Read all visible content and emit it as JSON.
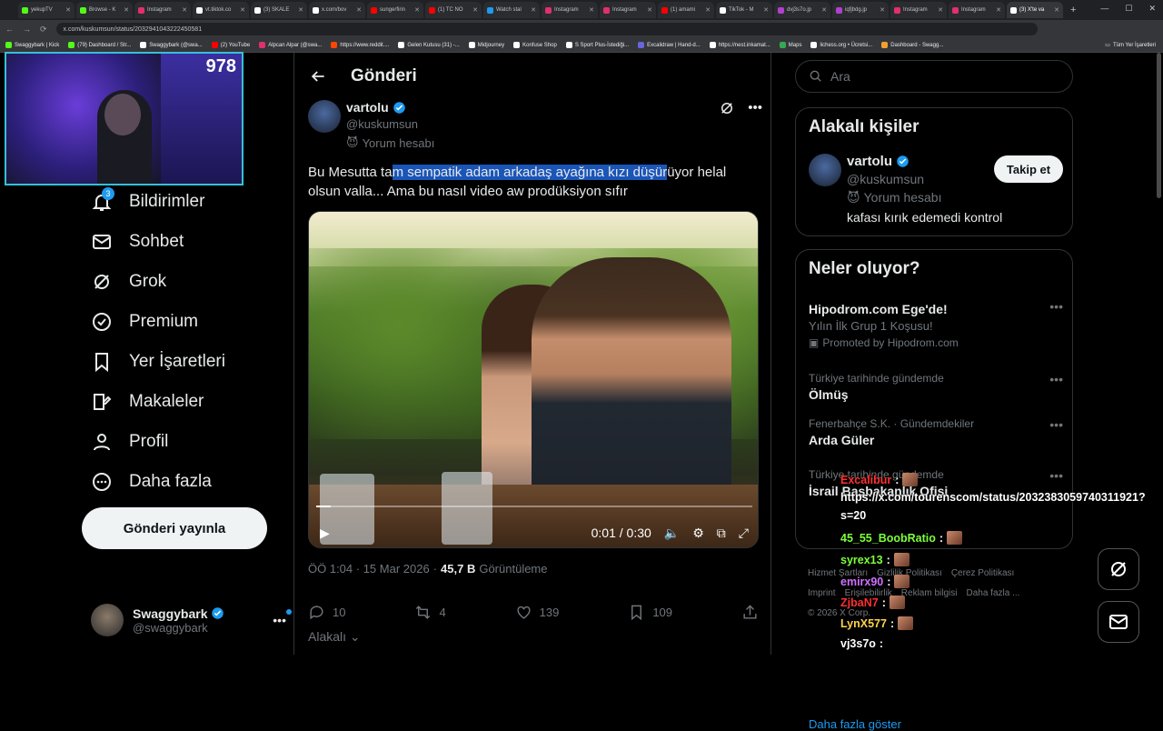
{
  "browser": {
    "tabs": [
      {
        "label": "yekupTV",
        "color": "#53fc18"
      },
      {
        "label": "Browse - K",
        "color": "#53fc18"
      },
      {
        "label": "Instagram",
        "color": "#e1306c"
      },
      {
        "label": "vt.tiktok.co",
        "color": "#ffffff"
      },
      {
        "label": "(3) SKALE",
        "color": "#ffffff"
      },
      {
        "label": "x.com/bov",
        "color": "#ffffff"
      },
      {
        "label": "sungerfirin",
        "color": "#ff0000"
      },
      {
        "label": "(1) TC NO",
        "color": "#ff0000"
      },
      {
        "label": "Watch stal",
        "color": "#1d9bf0"
      },
      {
        "label": "Instagram",
        "color": "#e1306c"
      },
      {
        "label": "Instagram",
        "color": "#e1306c"
      },
      {
        "label": "(1) amami",
        "color": "#ff0000"
      },
      {
        "label": "TikTok - M",
        "color": "#ffffff"
      },
      {
        "label": "dvj3s7o.jp",
        "color": "#b040d0"
      },
      {
        "label": "iqfjbdg.jp",
        "color": "#b040d0"
      },
      {
        "label": "Instagram",
        "color": "#e1306c"
      },
      {
        "label": "Instagram",
        "color": "#e1306c"
      },
      {
        "label": "(3) X'te va",
        "color": "#ffffff"
      }
    ],
    "url": "x.com/kuskumsun/status/2032941043222450581",
    "bookmarks": [
      {
        "label": "Swaggybark | Kick",
        "color": "#53fc18"
      },
      {
        "label": "(79) Dashboard / Str...",
        "color": "#53fc18"
      },
      {
        "label": "Swaggybark (@swa...",
        "color": "#ffffff"
      },
      {
        "label": "(2) YouTube",
        "color": "#ff0000"
      },
      {
        "label": "Alpcan Alpar (@swa...",
        "color": "#e1306c"
      },
      {
        "label": "https://www.reddit....",
        "color": "#ff4500"
      },
      {
        "label": "Gelen Kutusu (31) -...",
        "color": "#ffffff"
      },
      {
        "label": "Midjourney",
        "color": "#ffffff"
      },
      {
        "label": "Konfuse Shop",
        "color": "#ffffff"
      },
      {
        "label": "S Sport Plus-İstediği...",
        "color": "#ffffff"
      },
      {
        "label": "Excalidraw | Hand-d...",
        "color": "#6965db"
      },
      {
        "label": "https://nest.inkamat...",
        "color": "#ffffff"
      },
      {
        "label": "Maps",
        "color": "#34a853"
      },
      {
        "label": "lichess.org • Ücretsi...",
        "color": "#ffffff"
      },
      {
        "label": "Dashboard - Swagg...",
        "color": "#f0a030"
      }
    ],
    "all_bookmarks": "Tüm Yer İşaretleri"
  },
  "webcam": {
    "viewer_count": "978"
  },
  "sidebar": {
    "notif_badge": "3",
    "items": [
      {
        "label": "Bildirimler",
        "icon": "bell-icon"
      },
      {
        "label": "Sohbet",
        "icon": "mail-icon"
      },
      {
        "label": "Grok",
        "icon": "grok-icon"
      },
      {
        "label": "Premium",
        "icon": "premium-icon"
      },
      {
        "label": "Yer İşaretleri",
        "icon": "bookmark-icon"
      },
      {
        "label": "Makaleler",
        "icon": "article-icon"
      },
      {
        "label": "Profil",
        "icon": "profile-icon"
      },
      {
        "label": "Daha fazla",
        "icon": "more-circle-icon"
      }
    ],
    "post_button": "Gönderi yayınla",
    "account": {
      "name": "Swaggybark",
      "handle": "@swaggybark"
    }
  },
  "post": {
    "header": "Gönderi",
    "author": {
      "name": "vartolu",
      "handle": "@kuskumsun",
      "account_type": "Yorum hesabı"
    },
    "text_before": "Bu Mesutta ta",
    "text_highlight": "m sempatik adam arkadaş ayağına kızı düşür",
    "text_after": "üyor helal olsun valla... Ama bu nasıl video aw prodüksiyon sıfır",
    "video": {
      "time": "0:01 / 0:30",
      "progress": 0.033
    },
    "time": "ÖÖ 1:04 · 15 Mar 2026",
    "views_count": "45,7 B",
    "views_label": "Görüntüleme",
    "replies": "10",
    "reposts": "4",
    "likes": "139",
    "bookmarks": "109",
    "related": "Alakalı"
  },
  "right": {
    "search_placeholder": "Ara",
    "related_people": {
      "title": "Alakalı kişiler",
      "name": "vartolu",
      "handle": "@kuskumsun",
      "account_type": "Yorum hesabı",
      "bio": "kafası kırık edemedi kontrol",
      "follow": "Takip et"
    },
    "trends_title": "Neler oluyor?",
    "trends": [
      {
        "ctx": "",
        "title": "Hipodrom.com Ege'de!",
        "sub": "Yılın İlk Grup 1 Koşusu!",
        "promo": "Promoted by Hipodrom.com"
      },
      {
        "ctx": "Türkiye tarihinde gündemde",
        "title": "Ölmüş"
      },
      {
        "ctx": "Fenerbahçe S.K. · Gündemdekiler",
        "title": "Arda Güler"
      },
      {
        "ctx": "Türkiye tarihinde gündemde",
        "title": "İsrail Başbakanlık Ofisi"
      }
    ],
    "show_more": "Daha fazla göster",
    "footer": [
      "Hizmet Şartları",
      "Gizlilik Politikası",
      "Çerez Politikası",
      "Imprint",
      "Erişilebilirlik",
      "Reklam bilgisi",
      "Daha fazla ...",
      "© 2026 X Corp."
    ]
  },
  "chat": [
    {
      "user": "Excalibur",
      "msg": "",
      "color": "#ff3030"
    },
    {
      "user": "",
      "msg": "https://x.com/tourenscom/status/2032383059740311921?",
      "color": "#ffffff"
    },
    {
      "user": "",
      "msg": "s=20",
      "color": "#ffffff"
    },
    {
      "user": "45_55_BoobRatio",
      "msg": "",
      "color": "#7cff3a"
    },
    {
      "user": "syrex13",
      "msg": "",
      "color": "#7cff3a"
    },
    {
      "user": "emirx90",
      "msg": "",
      "color": "#d070ff"
    },
    {
      "user": "ZjbaN7",
      "msg": "",
      "color": "#ff3030"
    },
    {
      "user": "LynX577",
      "msg": "",
      "color": "#ffd24a"
    },
    {
      "user": "vj3s7o",
      "msg": "",
      "color": "#ffffff"
    }
  ]
}
